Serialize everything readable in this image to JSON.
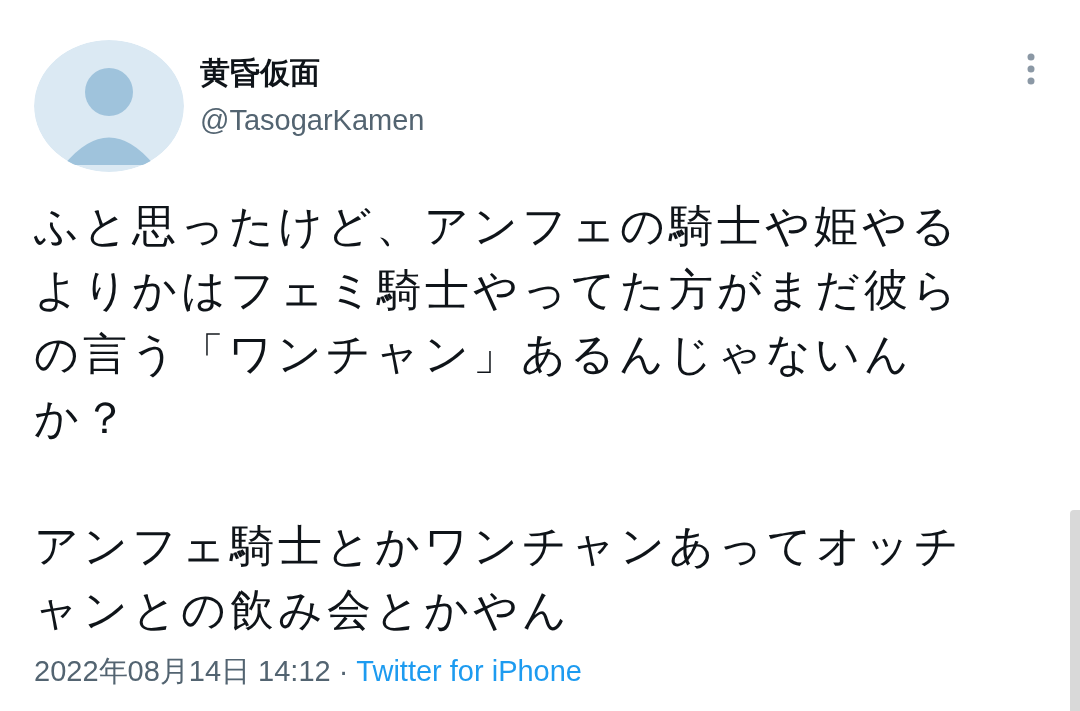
{
  "author": {
    "name": "黄昏仮面",
    "handle": "@TasogarKamen"
  },
  "tweet": {
    "paragraphs": [
      {
        "lines": [
          "ふと思ったけど、アンフェの騎士や姫やる",
          "よりかはフェミ騎士やってた方がまだ彼ら",
          "の言う「ワンチャン」あるんじゃないん",
          "か？"
        ]
      },
      {
        "lines": [
          "アンフェ騎士とかワンチャンあってオッチ",
          "ャンとの飲み会とかやん"
        ]
      }
    ]
  },
  "meta": {
    "timestamp": "2022年08月14日 14:12",
    "separator": "·",
    "source": "Twitter for iPhone"
  }
}
